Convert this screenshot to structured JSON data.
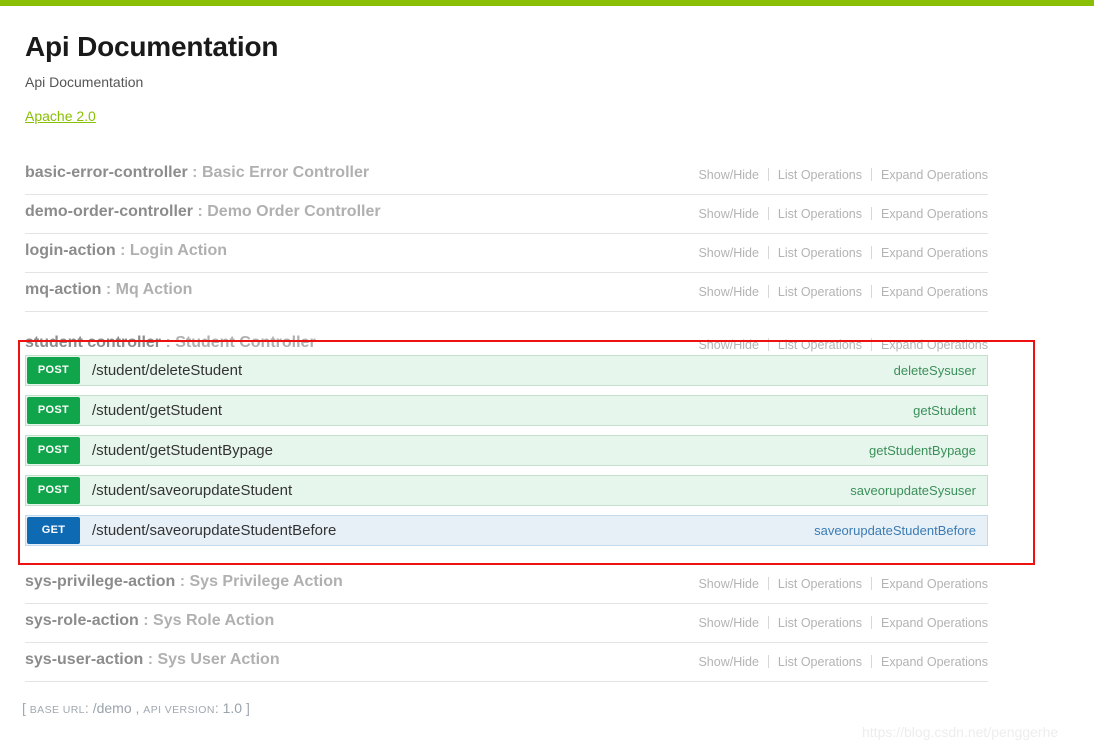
{
  "header": {
    "title": "Api Documentation",
    "subtitle": "Api Documentation",
    "license_label": "Apache 2.0"
  },
  "operation_links": {
    "show_hide": "Show/Hide",
    "list_operations": "List Operations",
    "expand_operations": "Expand Operations"
  },
  "resources_top": [
    {
      "name": "basic-error-controller",
      "separator": " : ",
      "description": "Basic Error Controller"
    },
    {
      "name": "demo-order-controller",
      "separator": " : ",
      "description": "Demo Order Controller"
    },
    {
      "name": "login-action",
      "separator": " : ",
      "description": "Login Action"
    },
    {
      "name": "mq-action",
      "separator": " : ",
      "description": "Mq Action"
    }
  ],
  "student_resource": {
    "name": "student controller",
    "separator": " : ",
    "description": "Student Controller",
    "operations": [
      {
        "method": "POST",
        "path": "/student/deleteStudent",
        "nickname": "deleteSysuser",
        "type": "post"
      },
      {
        "method": "POST",
        "path": "/student/getStudent",
        "nickname": "getStudent",
        "type": "post"
      },
      {
        "method": "POST",
        "path": "/student/getStudentBypage",
        "nickname": "getStudentBypage",
        "type": "post"
      },
      {
        "method": "POST",
        "path": "/student/saveorupdateStudent",
        "nickname": "saveorupdateSysuser",
        "type": "post"
      },
      {
        "method": "GET",
        "path": "/student/saveorupdateStudentBefore",
        "nickname": "saveorupdateStudentBefore",
        "type": "get"
      }
    ]
  },
  "resources_bottom": [
    {
      "name": "sys-privilege-action",
      "separator": " : ",
      "description": "Sys Privilege Action"
    },
    {
      "name": "sys-role-action",
      "separator": " : ",
      "description": "Sys Role Action"
    },
    {
      "name": "sys-user-action",
      "separator": " : ",
      "description": "Sys User Action"
    }
  ],
  "footer": {
    "open_bracket": "[ ",
    "base_url_label": "BASE URL",
    "base_url_sep": ": ",
    "base_url_value": "/demo",
    "comma": " , ",
    "api_version_label": "API VERSION",
    "api_version_sep": ": ",
    "api_version_value": "1.0",
    "close_bracket": " ]"
  },
  "watermark": "https://blog.csdn.net/penggerhe",
  "colors": {
    "topbar_green": "#89bf04",
    "post_green": "#10a54a",
    "get_blue": "#0f6ab4",
    "post_row_bg": "#e7f6ec",
    "get_row_bg": "#e7f0f7",
    "annotation_red": "#ee1111",
    "link_green": "#89bf04"
  }
}
